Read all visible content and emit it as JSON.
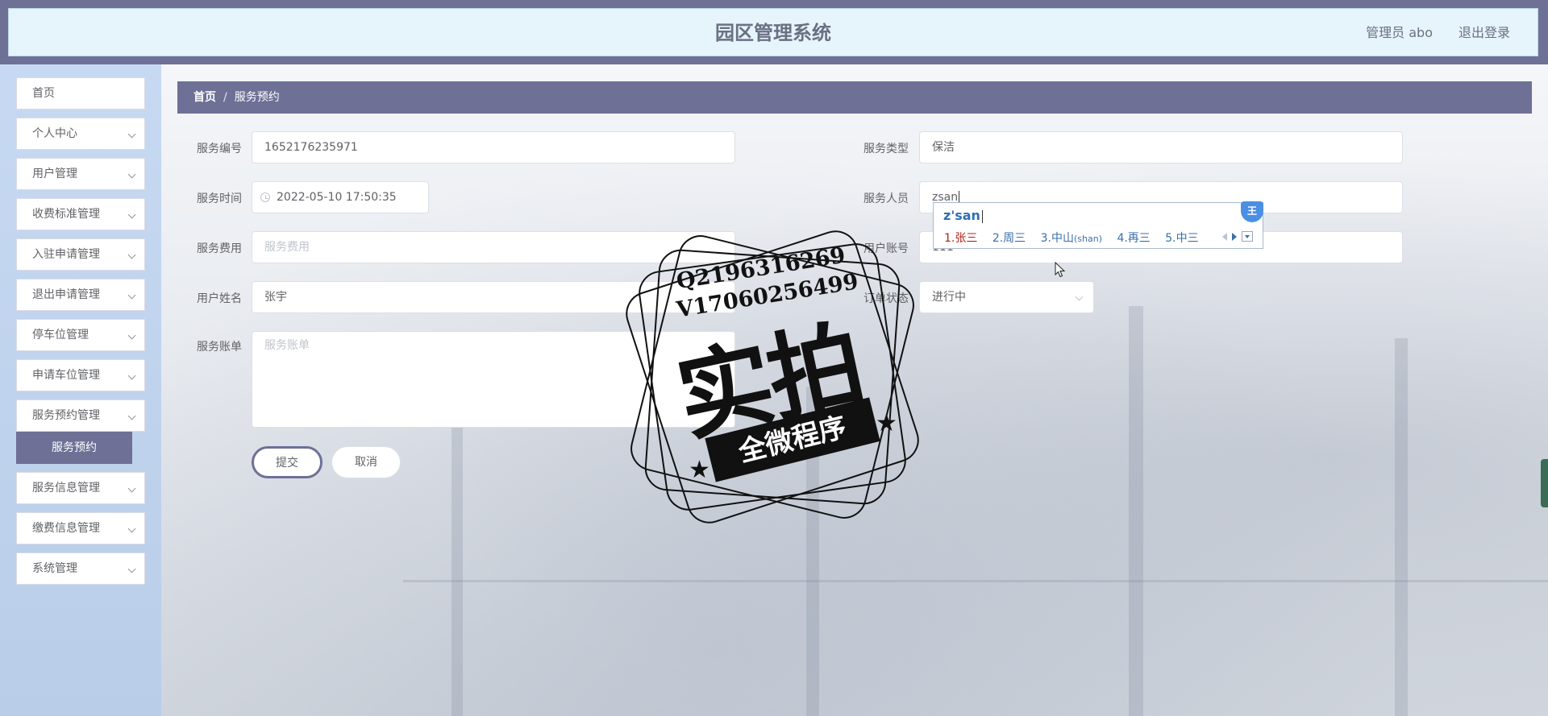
{
  "header": {
    "title": "园区管理系统",
    "user": "管理员 abo",
    "logout": "退出登录"
  },
  "sidebar": {
    "items": [
      {
        "label": "首页",
        "has_arrow": false
      },
      {
        "label": "个人中心",
        "has_arrow": true
      },
      {
        "label": "用户管理",
        "has_arrow": true
      },
      {
        "label": "收费标准管理",
        "has_arrow": true
      },
      {
        "label": "入驻申请管理",
        "has_arrow": true
      },
      {
        "label": "退出申请管理",
        "has_arrow": true
      },
      {
        "label": "停车位管理",
        "has_arrow": true
      },
      {
        "label": "申请车位管理",
        "has_arrow": true
      },
      {
        "label": "服务预约管理",
        "has_arrow": true
      },
      {
        "label": "服务信息管理",
        "has_arrow": true
      },
      {
        "label": "缴费信息管理",
        "has_arrow": true
      },
      {
        "label": "系统管理",
        "has_arrow": true
      }
    ],
    "active_sub": "服务预约"
  },
  "breadcrumb": {
    "home": "首页",
    "separator": "/",
    "current": "服务预约"
  },
  "form": {
    "service_no": {
      "label": "服务编号",
      "value": "1652176235971"
    },
    "service_type": {
      "label": "服务类型",
      "value": "保洁"
    },
    "service_time": {
      "label": "服务时间",
      "value": "2022-05-10 17:50:35"
    },
    "service_staff": {
      "label": "服务人员",
      "value": "zsan"
    },
    "service_fee": {
      "label": "服务费用",
      "placeholder": "服务费用"
    },
    "user_account": {
      "label": "用户账号",
      "value": "111"
    },
    "user_name": {
      "label": "用户姓名",
      "value": "张宇"
    },
    "order_status": {
      "label": "订单状态",
      "value": "进行中"
    },
    "service_bill": {
      "label": "服务账单",
      "placeholder": "服务账单"
    },
    "submit": "提交",
    "cancel": "取消"
  },
  "ime": {
    "composition": "z'san",
    "logo": "王",
    "candidates": [
      {
        "index": "1.",
        "text": "张三",
        "pinyin": ""
      },
      {
        "index": "2.",
        "text": "周三",
        "pinyin": ""
      },
      {
        "index": "3.",
        "text": "中山",
        "pinyin": "(shan)"
      },
      {
        "index": "4.",
        "text": "再三",
        "pinyin": ""
      },
      {
        "index": "5.",
        "text": "中三",
        "pinyin": ""
      }
    ]
  },
  "watermark": {
    "line1": "Q2196316269",
    "line2": "V17060256499",
    "big": "实拍",
    "banner": "全微程序"
  },
  "colors": {
    "accent": "#6e7096",
    "header_bg": "#e6f4fb",
    "sidebar_bg": "#c7d9f2"
  }
}
